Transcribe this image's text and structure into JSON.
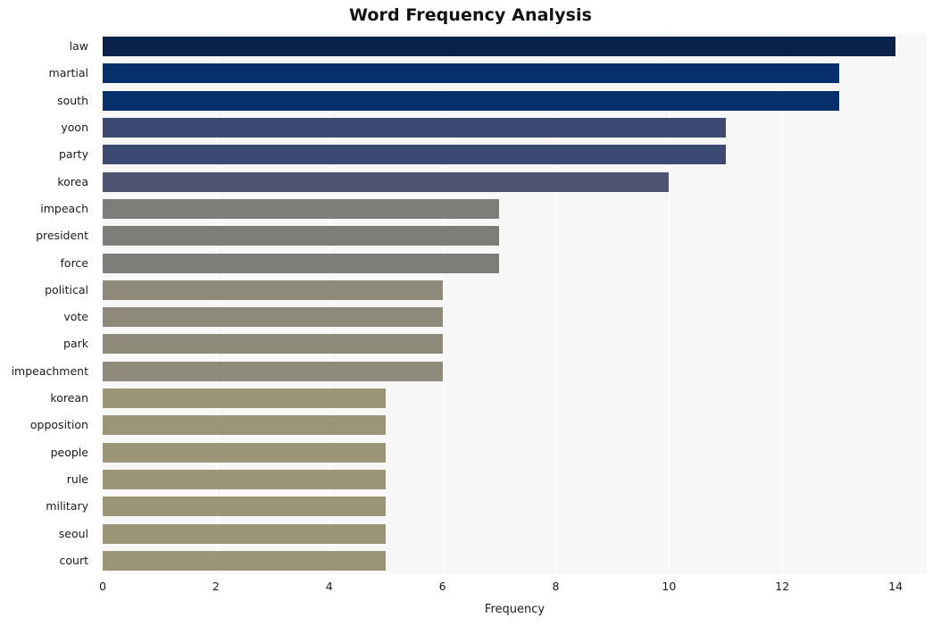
{
  "chart_data": {
    "type": "bar",
    "orientation": "horizontal",
    "title": "Word Frequency Analysis",
    "xlabel": "Frequency",
    "ylabel": "",
    "categories": [
      "law",
      "martial",
      "south",
      "yoon",
      "party",
      "korea",
      "impeach",
      "president",
      "force",
      "political",
      "vote",
      "park",
      "impeachment",
      "korean",
      "opposition",
      "people",
      "rule",
      "military",
      "seoul",
      "court"
    ],
    "values": [
      14,
      13,
      13,
      11,
      11,
      10,
      7,
      7,
      7,
      6,
      6,
      6,
      6,
      5,
      5,
      5,
      5,
      5,
      5,
      5
    ],
    "bar_colors": [
      "#0a2248",
      "#05306b",
      "#05306b",
      "#3c4a72",
      "#3c4a72",
      "#4c5472",
      "#7e7d7a",
      "#7e7d7a",
      "#7e7d7a",
      "#8e8a79",
      "#8e8a79",
      "#8e8a79",
      "#8e8a79",
      "#9c9577",
      "#9c9577",
      "#9c9577",
      "#9c9577",
      "#9c9577",
      "#9c9577",
      "#9c9577"
    ],
    "xlim": [
      0,
      14.55
    ],
    "xticks": [
      0,
      2,
      4,
      6,
      8,
      10,
      12,
      14
    ],
    "xtick_labels": [
      "0",
      "2",
      "4",
      "6",
      "8",
      "10",
      "12",
      "14"
    ],
    "grid": true,
    "grid_axis": "x",
    "grid_color": "#ffffff",
    "plot_background": "#f7f7f7",
    "figure_background": "#ffffff",
    "legend": null
  }
}
